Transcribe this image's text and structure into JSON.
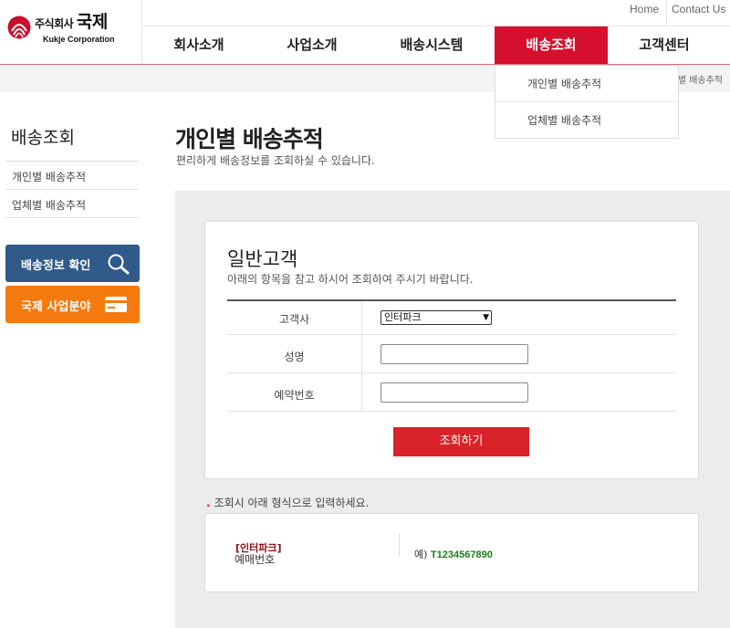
{
  "brand": {
    "name_ko_prefix": "주식회사",
    "name_ko_main": "국제",
    "name_en": "Kukje Corporation"
  },
  "util_nav": {
    "home": "Home",
    "contact": "Contact Us"
  },
  "gnb": [
    {
      "label": "회사소개"
    },
    {
      "label": "사업소개"
    },
    {
      "label": "배송시스템"
    },
    {
      "label": "배송조회"
    },
    {
      "label": "고객센터"
    }
  ],
  "dropdown": [
    "개인별 배송추적",
    "업체별 배송추적"
  ],
  "breadcrumb": "별 배송추적",
  "sidebar": {
    "title": "배송조회",
    "items": [
      "개인별 배송추적",
      "업체별 배송추적"
    ],
    "buttons": [
      {
        "label": "배송정보 확인",
        "icon": "search-icon",
        "color": "#2f5a8a"
      },
      {
        "label": "국제 사업분야",
        "icon": "card-icon",
        "color": "#f47a0f"
      }
    ]
  },
  "page": {
    "title": "개인별 배송추적",
    "subtitle": "편리하게 배송정보를 조회하실 수 있습니다."
  },
  "form": {
    "title": "일반고객",
    "desc": "아래의 항목을 참고 하시어 조회하여 주시기 바랍니다.",
    "fields": [
      {
        "label": "고객사",
        "value": "인터파크"
      },
      {
        "label": "성명",
        "value": ""
      },
      {
        "label": "예약번호",
        "value": ""
      }
    ],
    "submit": "조회하기"
  },
  "note": "조회시 아래 형식으로 입력하세요.",
  "example": {
    "brand": "[인터파크]",
    "label": "예매번호",
    "prefix": "예)",
    "value": "T1234567890"
  },
  "colors": {
    "accent": "#d4102e",
    "button_blue": "#2f5a8a",
    "button_orange": "#f47a0f",
    "example_green": "#1d7a1d"
  }
}
